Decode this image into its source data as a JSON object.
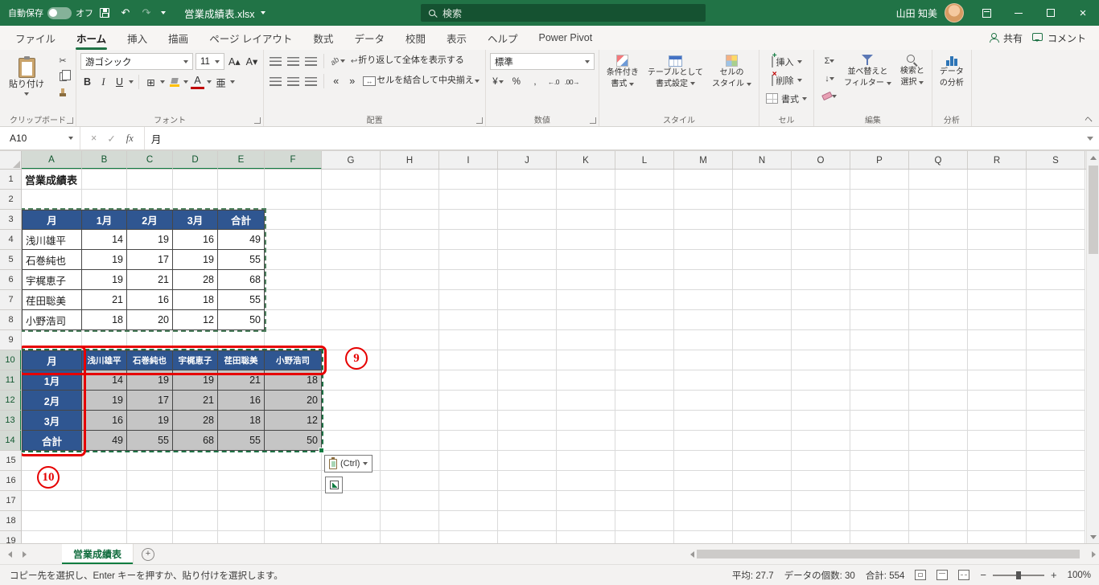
{
  "titlebar": {
    "autosave_label": "自動保存",
    "autosave_state": "オフ",
    "filename": "営業成績表.xlsx",
    "search_placeholder": "検索",
    "user_name": "山田 知美"
  },
  "ribbon_tabs": [
    {
      "id": "file",
      "label": "ファイル",
      "active": false
    },
    {
      "id": "home",
      "label": "ホーム",
      "active": true
    },
    {
      "id": "insert",
      "label": "挿入",
      "active": false
    },
    {
      "id": "draw",
      "label": "描画",
      "active": false
    },
    {
      "id": "page-layout",
      "label": "ページ レイアウト",
      "active": false
    },
    {
      "id": "formulas",
      "label": "数式",
      "active": false
    },
    {
      "id": "data",
      "label": "データ",
      "active": false
    },
    {
      "id": "review",
      "label": "校閲",
      "active": false
    },
    {
      "id": "view",
      "label": "表示",
      "active": false
    },
    {
      "id": "help",
      "label": "ヘルプ",
      "active": false
    },
    {
      "id": "power-pivot",
      "label": "Power Pivot",
      "active": false
    }
  ],
  "tab_actions": {
    "share": "共有",
    "comments": "コメント"
  },
  "ribbon": {
    "clipboard": {
      "paste": "貼り付け",
      "group": "クリップボード"
    },
    "font": {
      "name": "游ゴシック",
      "size": "11",
      "group": "フォント"
    },
    "alignment": {
      "wrap": "折り返して全体を表示する",
      "merge": "セルを結合して中央揃え",
      "group": "配置"
    },
    "number": {
      "format": "標準",
      "group": "数値"
    },
    "styles": {
      "conditional": [
        "条件付き",
        "書式"
      ],
      "table": [
        "テーブルとして",
        "書式設定"
      ],
      "cell": [
        "セルの",
        "スタイル"
      ],
      "group": "スタイル"
    },
    "cells": {
      "insert": "挿入",
      "delete": "削除",
      "format": "書式",
      "group": "セル"
    },
    "editing": {
      "sort": [
        "並べ替えと",
        "フィルター"
      ],
      "find": [
        "検索と",
        "選択"
      ],
      "group": "編集"
    },
    "analysis": {
      "label": [
        "データ",
        "の分析"
      ],
      "group": "分析"
    }
  },
  "icons": {
    "undo": "↶",
    "redo": "↷",
    "cut": "✂",
    "bold": "B",
    "italic": "I",
    "underline": "U",
    "borders": "⊞",
    "font_color": "A",
    "phonetic": "亜",
    "increase_font": "A▴",
    "decrease_font": "A▾",
    "orientation": "ab",
    "wrap": "↩",
    "merge_glyph": "↔",
    "indent_dec": "«",
    "indent_inc": "»",
    "currency": "¥",
    "percent": "%",
    "comma": ",",
    "increase_decimal": "←.0",
    "decrease_decimal": ".00→",
    "autosum": "Σ",
    "fill_glyph": "↓",
    "fx": "fx",
    "cancel": "×",
    "enter": "✓",
    "collapse_ribbon": "ヘ"
  },
  "formula_bar": {
    "name_box": "A10",
    "value": "月"
  },
  "grid": {
    "columns": [
      "A",
      "B",
      "C",
      "D",
      "E",
      "F",
      "G",
      "H",
      "I",
      "J",
      "K",
      "L",
      "M",
      "N",
      "O",
      "P",
      "Q",
      "R",
      "S"
    ],
    "selected_columns": [
      "A",
      "B",
      "C",
      "D",
      "E",
      "F"
    ],
    "rows": 19,
    "selected_rows": [
      10,
      11,
      12,
      13,
      14
    ],
    "copy_source_range": "A3:E8",
    "paste_range": "A10:F14",
    "cells": [
      {
        "c": "A",
        "r": 1,
        "t": "営業成績表",
        "s": "title"
      },
      {
        "c": "A",
        "r": 3,
        "t": "月",
        "s": "hdr"
      },
      {
        "c": "B",
        "r": 3,
        "t": "1月",
        "s": "hdr"
      },
      {
        "c": "C",
        "r": 3,
        "t": "2月",
        "s": "hdr"
      },
      {
        "c": "D",
        "r": 3,
        "t": "3月",
        "s": "hdr"
      },
      {
        "c": "E",
        "r": 3,
        "t": "合計",
        "s": "hdr"
      },
      {
        "c": "A",
        "r": 4,
        "t": "浅川雄平",
        "s": "name"
      },
      {
        "c": "B",
        "r": 4,
        "t": "14",
        "s": "num"
      },
      {
        "c": "C",
        "r": 4,
        "t": "19",
        "s": "num"
      },
      {
        "c": "D",
        "r": 4,
        "t": "16",
        "s": "num"
      },
      {
        "c": "E",
        "r": 4,
        "t": "49",
        "s": "num"
      },
      {
        "c": "A",
        "r": 5,
        "t": "石巻純也",
        "s": "name"
      },
      {
        "c": "B",
        "r": 5,
        "t": "19",
        "s": "num"
      },
      {
        "c": "C",
        "r": 5,
        "t": "17",
        "s": "num"
      },
      {
        "c": "D",
        "r": 5,
        "t": "19",
        "s": "num"
      },
      {
        "c": "E",
        "r": 5,
        "t": "55",
        "s": "num"
      },
      {
        "c": "A",
        "r": 6,
        "t": "宇梶恵子",
        "s": "name"
      },
      {
        "c": "B",
        "r": 6,
        "t": "19",
        "s": "num"
      },
      {
        "c": "C",
        "r": 6,
        "t": "21",
        "s": "num"
      },
      {
        "c": "D",
        "r": 6,
        "t": "28",
        "s": "num"
      },
      {
        "c": "E",
        "r": 6,
        "t": "68",
        "s": "num"
      },
      {
        "c": "A",
        "r": 7,
        "t": "荏田聡美",
        "s": "name"
      },
      {
        "c": "B",
        "r": 7,
        "t": "21",
        "s": "num"
      },
      {
        "c": "C",
        "r": 7,
        "t": "16",
        "s": "num"
      },
      {
        "c": "D",
        "r": 7,
        "t": "18",
        "s": "num"
      },
      {
        "c": "E",
        "r": 7,
        "t": "55",
        "s": "num"
      },
      {
        "c": "A",
        "r": 8,
        "t": "小野浩司",
        "s": "name"
      },
      {
        "c": "B",
        "r": 8,
        "t": "18",
        "s": "num"
      },
      {
        "c": "C",
        "r": 8,
        "t": "20",
        "s": "num"
      },
      {
        "c": "D",
        "r": 8,
        "t": "12",
        "s": "num"
      },
      {
        "c": "E",
        "r": 8,
        "t": "50",
        "s": "num"
      },
      {
        "c": "A",
        "r": 10,
        "t": "月",
        "s": "hdr"
      },
      {
        "c": "B",
        "r": 10,
        "t": "浅川雄平",
        "s": "hdrS"
      },
      {
        "c": "C",
        "r": 10,
        "t": "石巻純也",
        "s": "hdrS"
      },
      {
        "c": "D",
        "r": 10,
        "t": "宇梶恵子",
        "s": "hdrS"
      },
      {
        "c": "E",
        "r": 10,
        "t": "荏田聡美",
        "s": "hdrS"
      },
      {
        "c": "F",
        "r": 10,
        "t": "小野浩司",
        "s": "hdrS"
      },
      {
        "c": "A",
        "r": 11,
        "t": "1月",
        "s": "hdr"
      },
      {
        "c": "B",
        "r": 11,
        "t": "14",
        "s": "numsel"
      },
      {
        "c": "C",
        "r": 11,
        "t": "19",
        "s": "numsel"
      },
      {
        "c": "D",
        "r": 11,
        "t": "19",
        "s": "numsel"
      },
      {
        "c": "E",
        "r": 11,
        "t": "21",
        "s": "numsel"
      },
      {
        "c": "F",
        "r": 11,
        "t": "18",
        "s": "numsel"
      },
      {
        "c": "A",
        "r": 12,
        "t": "2月",
        "s": "hdr"
      },
      {
        "c": "B",
        "r": 12,
        "t": "19",
        "s": "numsel"
      },
      {
        "c": "C",
        "r": 12,
        "t": "17",
        "s": "numsel"
      },
      {
        "c": "D",
        "r": 12,
        "t": "21",
        "s": "numsel"
      },
      {
        "c": "E",
        "r": 12,
        "t": "16",
        "s": "numsel"
      },
      {
        "c": "F",
        "r": 12,
        "t": "20",
        "s": "numsel"
      },
      {
        "c": "A",
        "r": 13,
        "t": "3月",
        "s": "hdr"
      },
      {
        "c": "B",
        "r": 13,
        "t": "16",
        "s": "numsel"
      },
      {
        "c": "C",
        "r": 13,
        "t": "19",
        "s": "numsel"
      },
      {
        "c": "D",
        "r": 13,
        "t": "28",
        "s": "numsel"
      },
      {
        "c": "E",
        "r": 13,
        "t": "18",
        "s": "numsel"
      },
      {
        "c": "F",
        "r": 13,
        "t": "12",
        "s": "numsel"
      },
      {
        "c": "A",
        "r": 14,
        "t": "合計",
        "s": "hdr"
      },
      {
        "c": "B",
        "r": 14,
        "t": "49",
        "s": "numsel"
      },
      {
        "c": "C",
        "r": 14,
        "t": "55",
        "s": "numsel"
      },
      {
        "c": "D",
        "r": 14,
        "t": "68",
        "s": "numsel"
      },
      {
        "c": "E",
        "r": 14,
        "t": "55",
        "s": "numsel"
      },
      {
        "c": "F",
        "r": 14,
        "t": "50",
        "s": "numsel"
      }
    ]
  },
  "annotations": {
    "badge_9": "9",
    "badge_10": "10",
    "paste_options_label": "(Ctrl)"
  },
  "sheet_tabs": {
    "active": "営業成績表"
  },
  "status_bar": {
    "message": "コピー先を選択し、Enter キーを押すか、貼り付けを選択します。",
    "average": "平均: 27.7",
    "count": "データの個数: 30",
    "sum": "合計: 554",
    "zoom": "100%"
  },
  "colors": {
    "excel_green": "#217346",
    "header_blue": "#2f5691",
    "annotation_red": "#e60000",
    "selection_gray": "#c5c5c5"
  }
}
